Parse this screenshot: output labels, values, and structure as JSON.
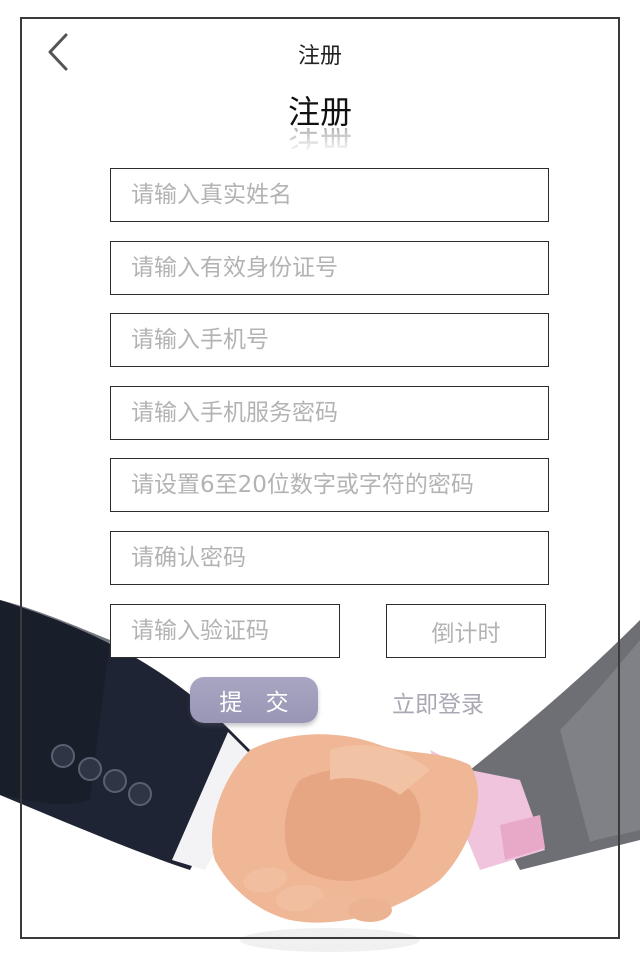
{
  "nav": {
    "title": "注册"
  },
  "header": {
    "title": "注册"
  },
  "form": {
    "fields": [
      {
        "placeholder": "请输入真实姓名"
      },
      {
        "placeholder": "请输入有效身份证号"
      },
      {
        "placeholder": "请输入手机号"
      },
      {
        "placeholder": "请输入手机服务密码"
      },
      {
        "placeholder": "请设置6至20位数字或字符的密码"
      },
      {
        "placeholder": "请确认密码"
      }
    ],
    "captcha": {
      "placeholder": "请输入验证码",
      "countdown_label": "倒计时"
    },
    "submit_label": "提 交",
    "login_label": "立即登录"
  },
  "icons": {
    "back": "chevron-left-icon",
    "background": "handshake-illustration"
  },
  "colors": {
    "submit_button": "#9e9cba",
    "placeholder_text": "#b3b3b3",
    "border": "#2c2c2c"
  }
}
